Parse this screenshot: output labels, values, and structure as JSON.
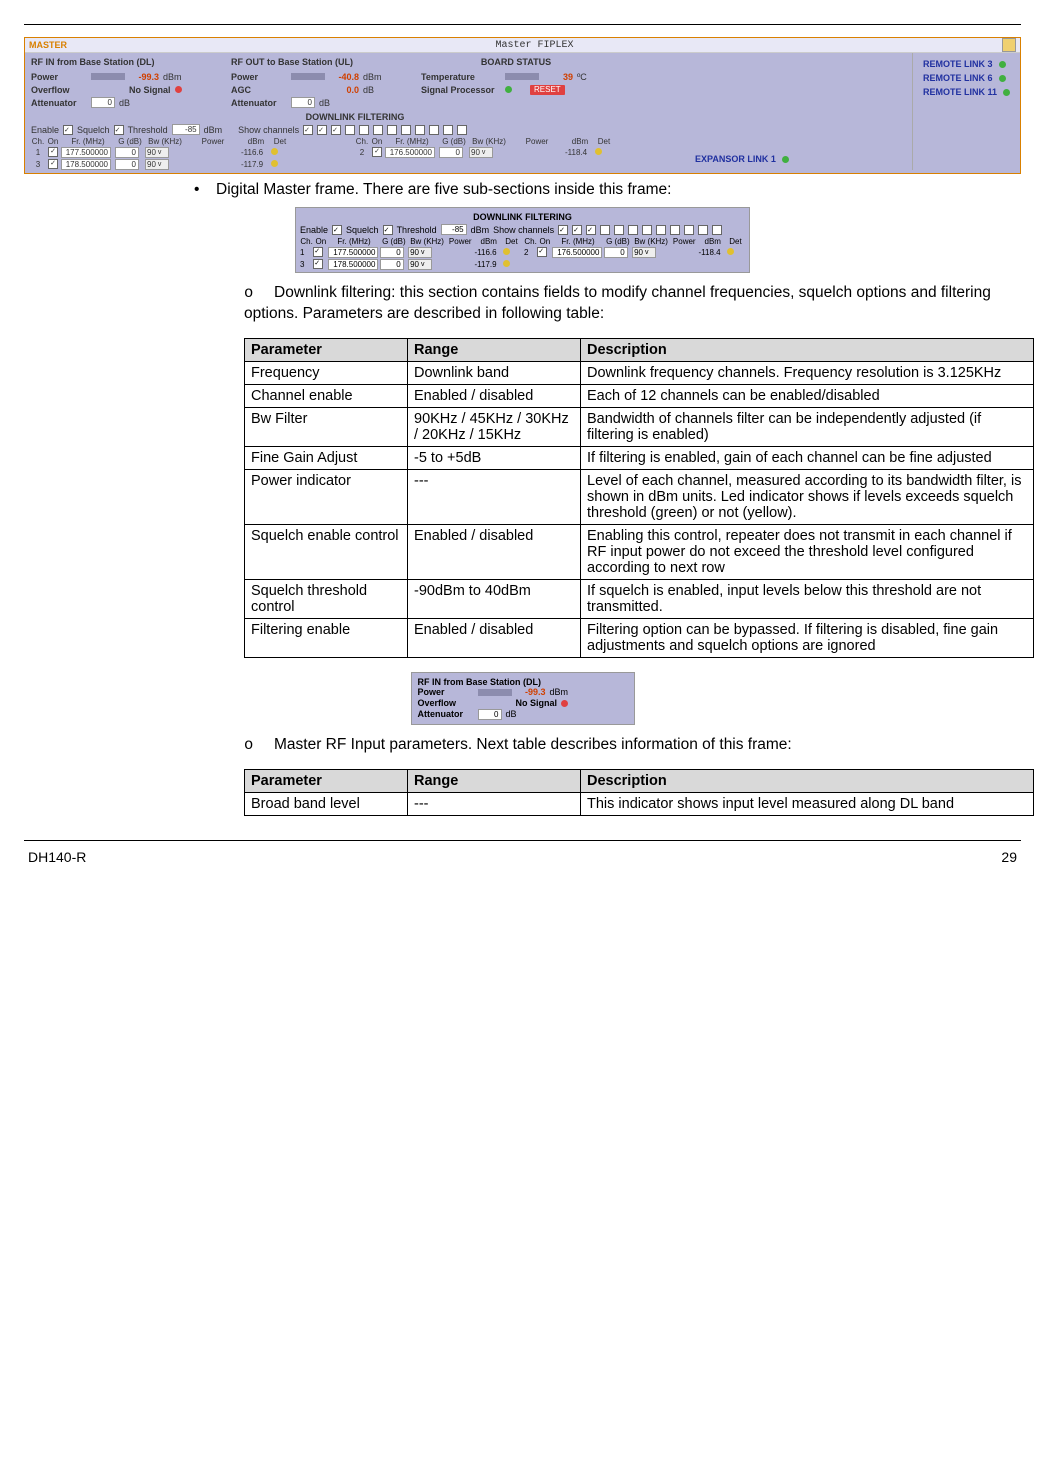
{
  "footer": {
    "left": "DH140-R",
    "right": "29"
  },
  "panel": {
    "title_left": "MASTER",
    "title_center": "Master FIPLEX",
    "rf_in": {
      "header": "RF IN from Base Station (DL)",
      "power_label": "Power",
      "power_val": "-99.3",
      "power_unit": "dBm",
      "overflow_label": "Overflow",
      "nosignal_label": "No Signal",
      "attn_label": "Attenuator",
      "attn_val": "0",
      "attn_unit": "dB"
    },
    "rf_out": {
      "header": "RF OUT to Base Station (UL)",
      "power_label": "Power",
      "power_val": "-40.8",
      "power_unit": "dBm",
      "agc_label": "AGC",
      "agc_val": "0.0",
      "agc_unit": "dB",
      "attn_label": "Attenuator",
      "attn_val": "0",
      "attn_unit": "dB"
    },
    "board": {
      "header": "BOARD STATUS",
      "temp_label": "Temperature",
      "temp_val": "39",
      "temp_unit": "ºC",
      "sp_label": "Signal Processor",
      "reset": "RESET"
    },
    "filter": {
      "title": "DOWNLINK FILTERING",
      "enable": "Enable",
      "squelch": "Squelch",
      "threshold": "Threshold",
      "thresh_val": "-85",
      "thresh_unit": "dBm",
      "showch": "Show channels",
      "cols": [
        "Ch.",
        "On",
        "Fr. (MHz)",
        "G (dB)",
        "Bw (KHz)",
        "Power",
        "dBm",
        "Det"
      ],
      "rows": [
        {
          "ch": "1",
          "fr": "177.500000",
          "g": "0",
          "bw": "90",
          "dbm": "-116.6"
        },
        {
          "ch": "3",
          "fr": "178.500000",
          "g": "0",
          "bw": "90",
          "dbm": "-117.9"
        },
        {
          "ch": "2",
          "fr": "176.500000",
          "g": "0",
          "bw": "90",
          "dbm": "-118.4"
        }
      ]
    },
    "expansor": {
      "name": "EXPANSOR LINK 1"
    },
    "remote": [
      {
        "name": "REMOTE LINK 3"
      },
      {
        "name": "REMOTE LINK 6"
      },
      {
        "name": "REMOTE LINK 11"
      }
    ]
  },
  "intro_bullet": "Digital Master frame. There are five  sub-sections inside this frame:",
  "sub1": "Downlink filtering: this section contains fields to modify channel frequencies, squelch options and filtering options. Parameters are described in following table:",
  "table1_head": {
    "p": "Parameter",
    "r": "Range",
    "d": "Description"
  },
  "table1": [
    {
      "p": "Frequency",
      "r": "Downlink band",
      "d": "Downlink frequency channels. Frequency resolution is 3.125KHz"
    },
    {
      "p": "Channel enable",
      "r": "Enabled / disabled",
      "d": "Each of 12 channels can be enabled/disabled"
    },
    {
      "p": "Bw Filter",
      "r": "90KHz / 45KHz / 30KHz / 20KHz / 15KHz",
      "d": "Bandwidth of channels filter can be independently adjusted (if filtering is enabled)"
    },
    {
      "p": "Fine Gain Adjust",
      "r": "-5 to +5dB",
      "d": "If filtering is enabled, gain of each channel can be fine adjusted"
    },
    {
      "p": "Power indicator",
      "r": "---",
      "d": "Level of each channel, measured according to its bandwidth filter, is shown in dBm units. Led indicator shows if levels exceeds squelch threshold (green) or not (yellow)."
    },
    {
      "p": "Squelch enable control",
      "r": "Enabled / disabled",
      "d": "Enabling this control, repeater does not transmit in each channel if RF input power do not exceed the threshold level configured according to next row"
    },
    {
      "p": "Squelch threshold control",
      "r": "-90dBm to 40dBm",
      "d": "If squelch is enabled, input levels below this threshold are not transmitted."
    },
    {
      "p": "Filtering enable",
      "r": "Enabled / disabled",
      "d": "Filtering option can be bypassed. If filtering is disabled, fine gain adjustments and squelch options are ignored"
    }
  ],
  "sub2": "Master RF Input parameters. Next table describes information of this frame:",
  "table2_head": {
    "p": "Parameter",
    "r": "Range",
    "d": "Description"
  },
  "table2": [
    {
      "p": "Broad band level",
      "r": "---",
      "d": "This indicator shows input level measured along DL band"
    }
  ]
}
